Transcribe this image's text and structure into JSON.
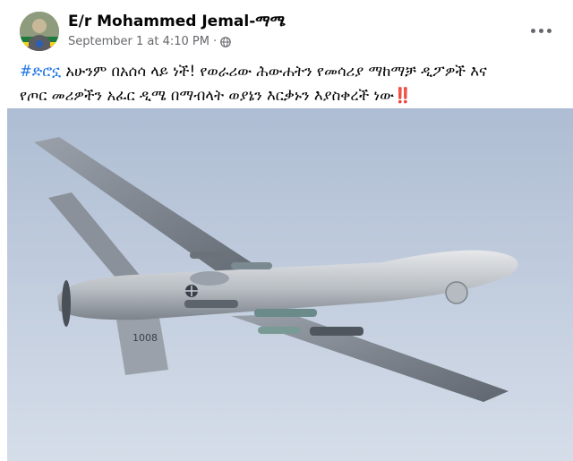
{
  "post": {
    "author": "E/r Mohammed Jemal-ማሜ",
    "timestamp": "September 1 at 4:10 PM",
    "separator": "·",
    "privacy_icon": "globe-icon",
    "more_icon": "more-options-icon",
    "hashtag": "#ድሮኗ",
    "text_line1": " አሁንም በአሰሳ ላይ ነች!  የወራሪው ሕውሐትን የመሳሪያ ማከማቻ ዲፖዎች  እና",
    "text_line2": "የጦር መሪዎችን አፈር ዲሜ በማብላት ወያኔን እርቃኑን እያስቀረች ነው",
    "exclamation": "‼️"
  },
  "photo": {
    "subject": "drone-image",
    "tail_code": "1008"
  },
  "colors": {
    "hashtag": "#1b74e4",
    "secondary_text": "#65676b",
    "sky_top": "#aebdd3",
    "sky_bottom": "#d5dde9"
  }
}
